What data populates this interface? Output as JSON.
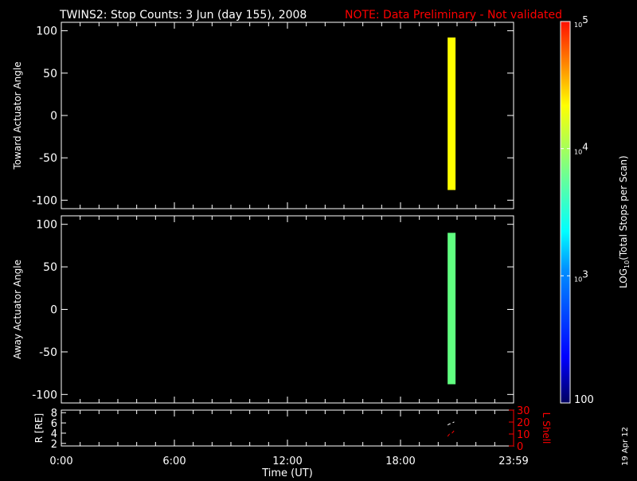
{
  "title": "TWINS2: Stop Counts:  3 Jun (day 155), 2008",
  "note": "NOTE: Data Preliminary - Not validated",
  "date_stamp": "19 Apr 12",
  "colors": {
    "note": "#ff0000",
    "axes": "#ffffff",
    "lshell": "#ff0000"
  },
  "chart_data": [
    {
      "type": "heatmap",
      "name": "toward",
      "ylabel": "Toward Actuator Angle",
      "ylim": [
        -110,
        110
      ],
      "yticks": [
        100,
        50,
        0,
        -50,
        -100
      ],
      "xlim": [
        0,
        24
      ],
      "cells": [
        {
          "t_start": 20.5,
          "t_end": 20.92,
          "angle_min": -88,
          "angle_max": 92,
          "log10_value": 4.1,
          "color": "#ffff00"
        }
      ]
    },
    {
      "type": "heatmap",
      "name": "away",
      "ylabel": "Away Actuator Angle",
      "ylim": [
        -110,
        110
      ],
      "yticks": [
        100,
        50,
        0,
        -50,
        -100
      ],
      "xlim": [
        0,
        24
      ],
      "cells": [
        {
          "t_start": 20.5,
          "t_end": 20.92,
          "angle_min": -88,
          "angle_max": 90,
          "log10_value": 3.7,
          "color": "#60ff80"
        }
      ]
    },
    {
      "type": "line",
      "name": "ephemeris",
      "ylabel": "R [RE]",
      "y2label": "L Shell",
      "ylim": [
        1.5,
        8.5
      ],
      "yticks": [
        "8",
        "6",
        "4",
        "2"
      ],
      "y2lim": [
        0,
        30
      ],
      "y2ticks": [
        "30",
        "20",
        "10",
        "0"
      ],
      "xlabel": "Time (UT)",
      "xticklabels": [
        "0:00",
        "6:00",
        "12:00",
        "18:00",
        "23:59"
      ],
      "xtick_hours": [
        0,
        6,
        12,
        18,
        24
      ],
      "series": [
        {
          "name": "R",
          "color": "#ffffff",
          "x": [
            20.5,
            20.6,
            20.75,
            20.85
          ],
          "y": [
            5.6,
            5.8,
            6.0,
            6.2
          ]
        },
        {
          "name": "L Shell",
          "color": "#ff0000",
          "x": [
            20.5,
            20.6,
            20.75,
            20.85
          ],
          "y": [
            8,
            10,
            11,
            13
          ]
        }
      ]
    }
  ],
  "colorbar": {
    "label": "LOG10(Total Stops per Scan)",
    "label_main": "LOG",
    "label_sub": "10",
    "label_rest": "(Total Stops per Scan)",
    "ticks": [
      {
        "base": "10",
        "exp": "5",
        "value": 5
      },
      {
        "base": "10",
        "exp": "4",
        "value": 4
      },
      {
        "base": "10",
        "exp": "3",
        "value": 3
      }
    ],
    "min_label": "100",
    "range": [
      2,
      5
    ]
  }
}
